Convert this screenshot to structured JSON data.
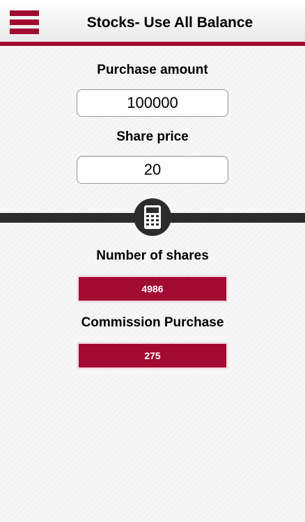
{
  "header": {
    "title": "Stocks- Use All Balance"
  },
  "inputs": {
    "purchase_amount": {
      "label": "Purchase amount",
      "value": "100000"
    },
    "share_price": {
      "label": "Share price",
      "value": "20"
    }
  },
  "results": {
    "number_of_shares": {
      "label": "Number of shares",
      "value": "4986"
    },
    "commission_purchase": {
      "label": "Commission Purchase",
      "value": "275"
    }
  },
  "icons": {
    "menu": "hamburger-menu-icon",
    "calculate": "calculator-icon"
  },
  "colors": {
    "accent": "#a30a32",
    "divider": "#2c2c2c",
    "result_text": "#ffffff"
  }
}
